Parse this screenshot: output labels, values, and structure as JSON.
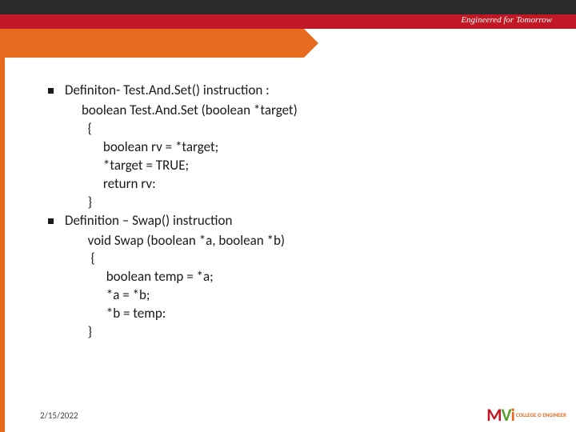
{
  "header": {
    "tagline": "Engineered for Tomorrow"
  },
  "bullets": [
    {
      "title": "Definiton- Test.And.Set() instruction :",
      "code": "boolean Test.And.Set (boolean *target)\n  {\n       boolean rv = *target;\n       *target = TRUE;\n       return rv:\n  }"
    },
    {
      "title": "Definition – Swap() instruction",
      "code": "  void Swap (boolean *a, boolean *b)\n   {\n        boolean temp = *a;\n        *a = *b;\n        *b = temp:\n  }"
    }
  ],
  "footer": {
    "date": "2/15/2022",
    "logo_text": "COLLEGE O\nENGINEER"
  }
}
